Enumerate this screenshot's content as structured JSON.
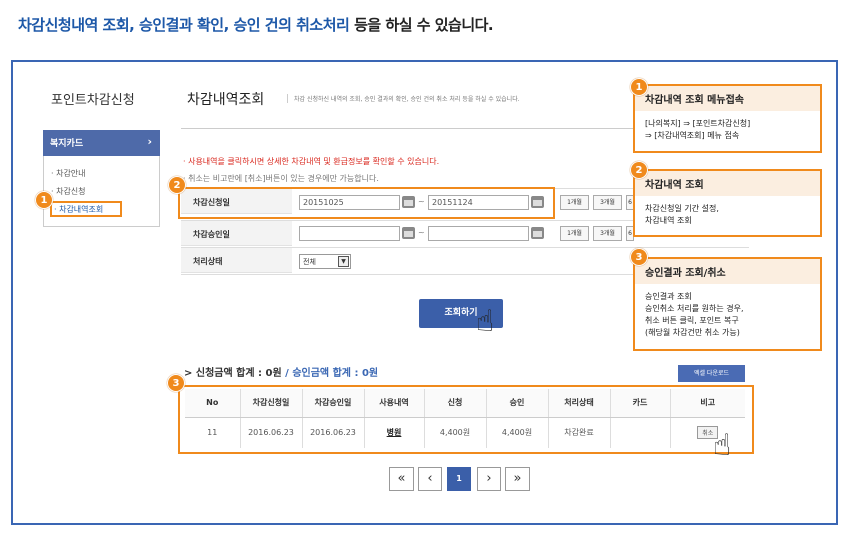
{
  "headline": {
    "highlight": "차감신청내역 조회, 승인결과 확인, 승인 건의 취소처리",
    "rest": " 등을 하실 수 있습니다."
  },
  "app": {
    "title": "포인트차감신청"
  },
  "left_nav": {
    "header": "복지카드",
    "items": [
      "· 차감안내",
      "· 차감신청",
      "· 차감내역조회"
    ]
  },
  "page": {
    "title": "차감내역조회",
    "subtitle": "차감 신청하신 내역의 조회, 승인 결과의 확인, 승인 건의 취소 처리 등을 하실 수 있습니다."
  },
  "notes": {
    "line1": "· 사용내역을 클릭하시면 상세한 차감내역 및 환급정보를 확인할 수 있습니다.",
    "line2": "· 취소는 비고란에 [취소]버튼이 있는 경우에만 가능합니다."
  },
  "form": {
    "apply_date_label": "차감신청일",
    "apply_from": "20151025",
    "apply_to": "20151124",
    "approve_date_label": "차감승인일",
    "approve_from": "",
    "approve_to": "",
    "tilde": "~",
    "periods": [
      "1개월",
      "3개월",
      "6"
    ],
    "status_label": "처리상태",
    "status_value": "전체",
    "status_arrow": "▼"
  },
  "search_button": "조회하기",
  "summary": {
    "apply_total": "신청금액 합계 : 0원",
    "slash": "/",
    "approve_total": "승인금액 합계 : 0원",
    "arrow": ">"
  },
  "excel_button": "엑셀 다운로드",
  "table": {
    "columns": [
      "No",
      "차감신청일",
      "차감승인일",
      "사용내역",
      "신청",
      "승인",
      "처리상태",
      "카드",
      "비고"
    ],
    "rows": [
      {
        "no": "11",
        "apply_date": "2016.06.23",
        "approve_date": "2016.06.23",
        "usage": "병원",
        "requested": "4,400원",
        "approved": "4,400원",
        "status": "차감완료",
        "card": "",
        "note": "취소"
      }
    ]
  },
  "pagination": {
    "first": "«",
    "prev": "‹",
    "current": "1",
    "next": "›",
    "last": "»"
  },
  "badges": [
    "1",
    "2",
    "3"
  ],
  "callouts": [
    {
      "number": "1",
      "title": "차감내역 조회 메뉴접속",
      "lines": [
        "[나의복지] ⇒ [포인트차감신청]",
        "⇒ [차감내역조회] 메뉴 접속"
      ]
    },
    {
      "number": "2",
      "title": "차감내역 조회",
      "lines": [
        "차감신청일 기간 설정,",
        "차감내역 조회"
      ]
    },
    {
      "number": "3",
      "title": "승인결과 조회/취소",
      "lines": [
        "승인결과 조회",
        "승인취소 처리를 원하는 경우,",
        "취소 버튼 클릭, 포인트 복구",
        "(해당월 차감건만 취소 가능)"
      ]
    }
  ],
  "colors": {
    "accent_blue": "#1d58a8",
    "highlight_orange": "#f08a1c",
    "button_blue": "#3b5fa9",
    "notice_red": "#d9261c"
  }
}
